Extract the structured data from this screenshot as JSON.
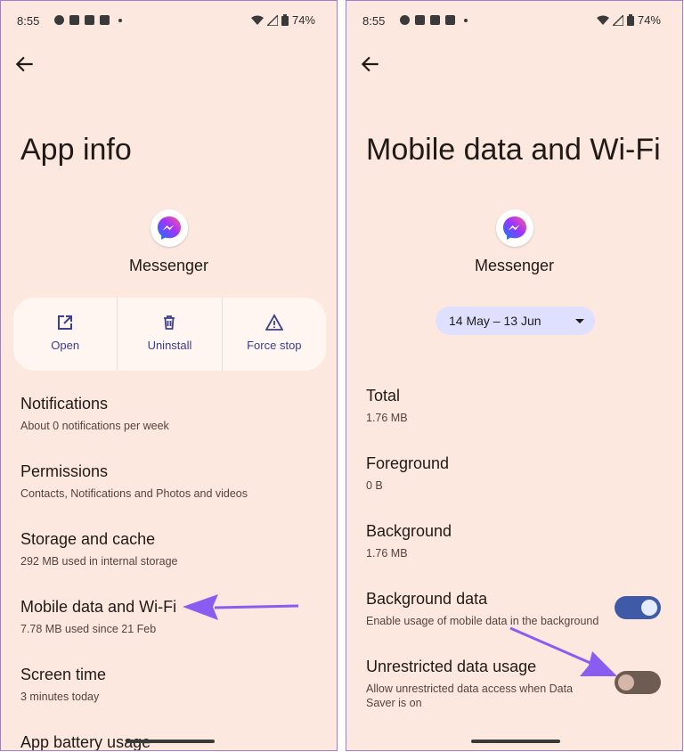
{
  "status_bar": {
    "time": "8:55",
    "battery": "74%"
  },
  "left": {
    "title": "App info",
    "app_name": "Messenger",
    "actions": [
      {
        "label": "Open",
        "icon": "open-external-icon"
      },
      {
        "label": "Uninstall",
        "icon": "trash-icon"
      },
      {
        "label": "Force stop",
        "icon": "warning-icon"
      }
    ],
    "items": [
      {
        "title": "Notifications",
        "subtitle": "About 0 notifications per week"
      },
      {
        "title": "Permissions",
        "subtitle": "Contacts, Notifications and Photos and videos"
      },
      {
        "title": "Storage and cache",
        "subtitle": "292 MB used in internal storage"
      },
      {
        "title": "Mobile data and Wi-Fi",
        "subtitle": "7.78 MB used since 21 Feb"
      },
      {
        "title": "Screen time",
        "subtitle": "3 minutes today"
      },
      {
        "title": "App battery usage",
        "subtitle": ""
      }
    ]
  },
  "right": {
    "title": "Mobile data and Wi-Fi",
    "app_name": "Messenger",
    "date_range": "14 May – 13 Jun",
    "stats": [
      {
        "title": "Total",
        "value": "1.76 MB"
      },
      {
        "title": "Foreground",
        "value": "0 B"
      },
      {
        "title": "Background",
        "value": "1.76 MB"
      }
    ],
    "toggles": [
      {
        "title": "Background data",
        "subtitle": "Enable usage of mobile data in the background",
        "on": true
      },
      {
        "title": "Unrestricted data usage",
        "subtitle": "Allow unrestricted data access when Data Saver is on",
        "on": false
      }
    ]
  },
  "colors": {
    "background": "#fde8e0",
    "accent": "#3f5aa6",
    "annotation_arrow": "#8a5cf0"
  }
}
